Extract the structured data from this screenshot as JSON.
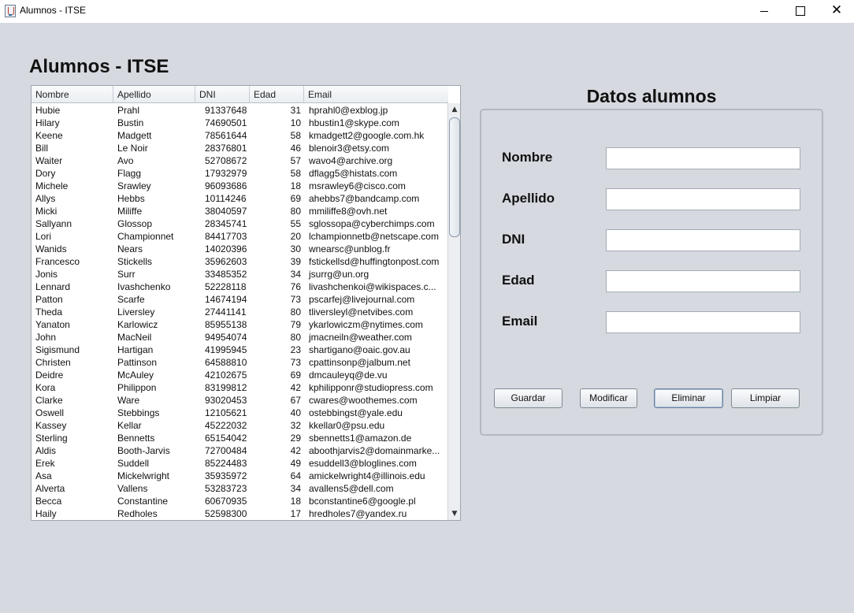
{
  "window": {
    "title": "Alumnos - ITSE"
  },
  "page": {
    "title": "Alumnos - ITSE"
  },
  "table": {
    "columns": [
      "Nombre",
      "Apellido",
      "DNI",
      "Edad",
      "Email"
    ],
    "rows": [
      [
        "Hubie",
        "Prahl",
        "91337648",
        "31",
        "hprahl0@exblog.jp"
      ],
      [
        "Hilary",
        "Bustin",
        "74690501",
        "10",
        "hbustin1@skype.com"
      ],
      [
        "Keene",
        "Madgett",
        "78561644",
        "58",
        "kmadgett2@google.com.hk"
      ],
      [
        "Bill",
        "Le Noir",
        "28376801",
        "46",
        "blenoir3@etsy.com"
      ],
      [
        "Waiter",
        "Avo",
        "52708672",
        "57",
        "wavo4@archive.org"
      ],
      [
        "Dory",
        "Flagg",
        "17932979",
        "58",
        "dflagg5@histats.com"
      ],
      [
        "Michele",
        "Srawley",
        "96093686",
        "18",
        "msrawley6@cisco.com"
      ],
      [
        "Allys",
        "Hebbs",
        "10114246",
        "69",
        "ahebbs7@bandcamp.com"
      ],
      [
        "Micki",
        "Miliffe",
        "38040597",
        "80",
        "mmiliffe8@ovh.net"
      ],
      [
        "Sallyann",
        "Glossop",
        "28345741",
        "55",
        "sglossopa@cyberchimps.com"
      ],
      [
        "Lori",
        "Championnet",
        "84417703",
        "20",
        "lchampionnetb@netscape.com"
      ],
      [
        "Wanids",
        "Nears",
        "14020396",
        "30",
        "wnearsc@unblog.fr"
      ],
      [
        "Francesco",
        "Stickells",
        "35962603",
        "39",
        "fstickellsd@huffingtonpost.com"
      ],
      [
        "Jonis",
        "Surr",
        "33485352",
        "34",
        "jsurrg@un.org"
      ],
      [
        "Lennard",
        "Ivashchenko",
        "52228118",
        "76",
        "livashchenkoi@wikispaces.c..."
      ],
      [
        "Patton",
        "Scarfe",
        "14674194",
        "73",
        "pscarfej@livejournal.com"
      ],
      [
        "Theda",
        "Liversley",
        "27441141",
        "80",
        "tliversleyl@netvibes.com"
      ],
      [
        "Yanaton",
        "Karlowicz",
        "85955138",
        "79",
        "ykarlowiczm@nytimes.com"
      ],
      [
        "John",
        "MacNeil",
        "94954074",
        "80",
        "jmacneiln@weather.com"
      ],
      [
        "Sigismund",
        "Hartigan",
        "41995945",
        "23",
        "shartigano@oaic.gov.au"
      ],
      [
        "Christen",
        "Pattinson",
        "64588810",
        "73",
        "cpattinsonp@jalbum.net"
      ],
      [
        "Deidre",
        "McAuley",
        "42102675",
        "69",
        "dmcauleyq@de.vu"
      ],
      [
        "Kora",
        "Philippon",
        "83199812",
        "42",
        "kphilipponr@studiopress.com"
      ],
      [
        "Clarke",
        "Ware",
        "93020453",
        "67",
        "cwares@woothemes.com"
      ],
      [
        "Oswell",
        "Stebbings",
        "12105621",
        "40",
        "ostebbingst@yale.edu"
      ],
      [
        "Kassey",
        "Kellar",
        "45222032",
        "32",
        "kkellar0@psu.edu"
      ],
      [
        "Sterling",
        "Bennetts",
        "65154042",
        "29",
        "sbennetts1@amazon.de"
      ],
      [
        "Aldis",
        "Booth-Jarvis",
        "72700484",
        "42",
        "aboothjarvis2@domainmarke..."
      ],
      [
        "Erek",
        "Suddell",
        "85224483",
        "49",
        "esuddell3@bloglines.com"
      ],
      [
        "Asa",
        "Mickelwright",
        "35935972",
        "64",
        "amickelwright4@illinois.edu"
      ],
      [
        "Alverta",
        "Vallens",
        "53283723",
        "34",
        "avallens5@dell.com"
      ],
      [
        "Becca",
        "Constantine",
        "60670935",
        "18",
        "bconstantine6@google.pl"
      ],
      [
        "Haily",
        "Redholes",
        "52598300",
        "17",
        "hredholes7@yandex.ru"
      ]
    ]
  },
  "form": {
    "title": "Datos alumnos",
    "labels": {
      "nombre": "Nombre",
      "apellido": "Apellido",
      "dni": "DNI",
      "edad": "Edad",
      "email": "Email"
    },
    "values": {
      "nombre": "",
      "apellido": "",
      "dni": "",
      "edad": "",
      "email": ""
    },
    "buttons": {
      "guardar": "Guardar",
      "modificar": "Modificar",
      "eliminar": "Eliminar",
      "limpiar": "Limpiar"
    }
  }
}
